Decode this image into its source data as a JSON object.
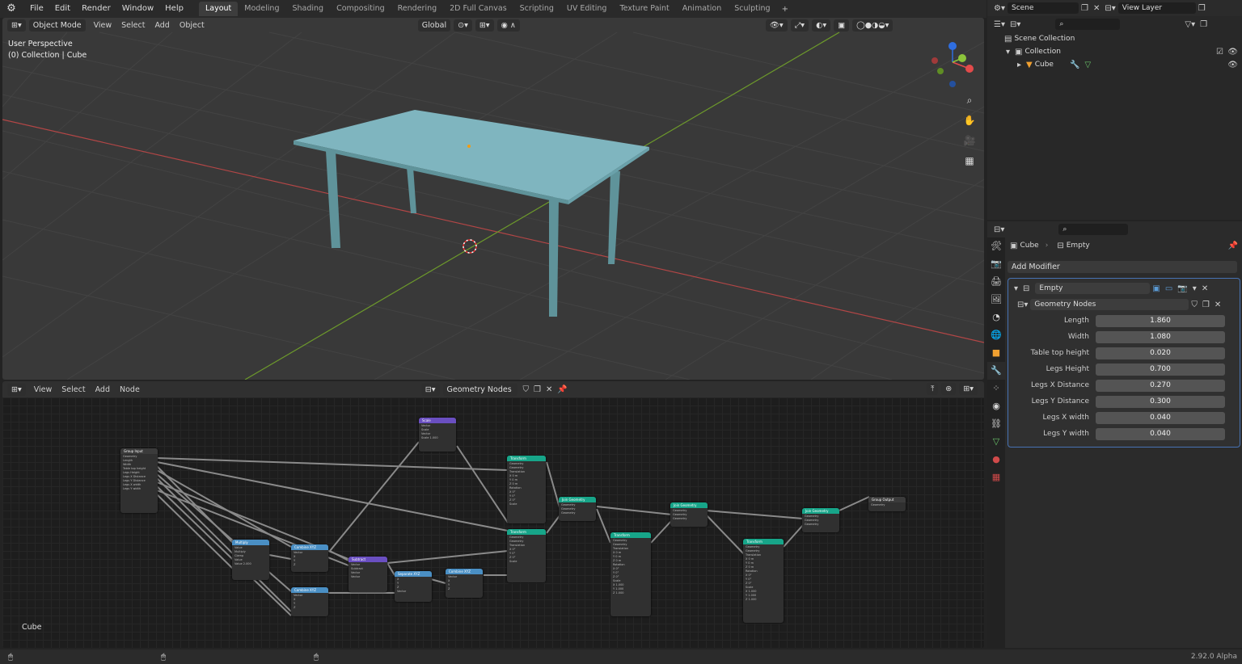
{
  "topbar": {
    "menus": [
      "File",
      "Edit",
      "Render",
      "Window",
      "Help"
    ],
    "workspaces": [
      "Layout",
      "Modeling",
      "Shading",
      "Compositing",
      "Rendering",
      "2D Full Canvas",
      "Scripting",
      "UV Editing",
      "Texture Paint",
      "Animation",
      "Sculpting"
    ],
    "active_workspace": "Layout",
    "plus": "+",
    "scene": "Scene",
    "view_layer": "View Layer"
  },
  "viewport": {
    "mode": "Object Mode",
    "menus": [
      "View",
      "Select",
      "Add",
      "Object"
    ],
    "orientation": "Global",
    "info_line1": "User Perspective",
    "info_line2": "(0) Collection | Cube",
    "tool_icons": [
      "zoom-icon",
      "hand-icon",
      "camera-icon",
      "grid-icon"
    ]
  },
  "node_editor": {
    "menus": [
      "View",
      "Select",
      "Add",
      "Node"
    ],
    "tree_name": "Geometry Nodes",
    "object_label": "Cube",
    "nodes": [
      {
        "id": "group_input",
        "title": "Group Input",
        "color": "#3b3b3b",
        "lines": [
          "Geometry",
          "Length",
          "Width",
          "Table top height",
          "Legs Height",
          "Legs X Distance",
          "Legs Y Distance",
          "Legs X width",
          "Legs Y width"
        ]
      },
      {
        "id": "scale",
        "title": "Scale",
        "color": "#6a4fc1",
        "lines": [
          "Vector",
          "Scale",
          "Vector",
          "Scale 1.000"
        ]
      },
      {
        "id": "multiply",
        "title": "Multiply",
        "color": "#4a8fc4",
        "lines": [
          "Value",
          "Multiply",
          "Clamp",
          "Value",
          "Value 2.000"
        ]
      },
      {
        "id": "combine1",
        "title": "Combine XYZ",
        "color": "#4a8fc4",
        "lines": [
          "Vector",
          "X",
          "Y",
          "Z"
        ]
      },
      {
        "id": "combine2",
        "title": "Combine XYZ",
        "color": "#4a8fc4",
        "lines": [
          "Vector",
          "X",
          "Y",
          "Z"
        ]
      },
      {
        "id": "subtract",
        "title": "Subtract",
        "color": "#6a4fc1",
        "lines": [
          "Vector",
          "Subtract",
          "Vector",
          "Vector"
        ]
      },
      {
        "id": "separate",
        "title": "Separate XYZ",
        "color": "#4a8fc4",
        "lines": [
          "X",
          "Y",
          "Z",
          "Vector"
        ]
      },
      {
        "id": "combine3",
        "title": "Combine XYZ",
        "color": "#4a8fc4",
        "lines": [
          "Vector",
          "X",
          "Y",
          "Z"
        ]
      },
      {
        "id": "transform1",
        "title": "Transform",
        "color": "#17a589",
        "lines": [
          "Geometry",
          "Geometry",
          "Translation",
          "X 0 m",
          "Y 0 m",
          "Z 0 m",
          "Rotation",
          "X 0°",
          "Y 0°",
          "Z 0°",
          "Scale"
        ]
      },
      {
        "id": "transform2",
        "title": "Transform",
        "color": "#17a589",
        "lines": [
          "Geometry",
          "Geometry",
          "Translation",
          "X 0°",
          "Y 0°",
          "Z 0°",
          "Scale"
        ]
      },
      {
        "id": "join1",
        "title": "Join Geometry",
        "color": "#17a589",
        "lines": [
          "Geometry",
          "Geometry",
          "Geometry"
        ]
      },
      {
        "id": "transform3",
        "title": "Transform",
        "color": "#17a589",
        "lines": [
          "Geometry",
          "Geometry",
          "Translation",
          "X 0 m",
          "Y 0 m",
          "Z 0 m",
          "Rotation",
          "X 0°",
          "Y 0°",
          "Z 0°",
          "Scale",
          "X 1.000",
          "Y 1.000",
          "Z 1.000"
        ]
      },
      {
        "id": "join2",
        "title": "Join Geometry",
        "color": "#17a589",
        "lines": [
          "Geometry",
          "Geometry",
          "Geometry"
        ]
      },
      {
        "id": "transform4",
        "title": "Transform",
        "color": "#17a589",
        "lines": [
          "Geometry",
          "Geometry",
          "Translation",
          "X 0 m",
          "Y 0 m",
          "Z 0 m",
          "Rotation",
          "X 0°",
          "Y 0°",
          "Z 0°",
          "Scale",
          "X 1.000",
          "Y 1.000",
          "Z 1.000"
        ]
      },
      {
        "id": "join3",
        "title": "Join Geometry",
        "color": "#17a589",
        "lines": [
          "Geometry",
          "Geometry",
          "Geometry"
        ]
      },
      {
        "id": "group_output",
        "title": "Group Output",
        "color": "#3b3b3b",
        "lines": [
          "Geometry"
        ]
      }
    ]
  },
  "outliner": {
    "scene_collection": "Scene Collection",
    "collection": "Collection",
    "object": "Cube"
  },
  "properties": {
    "object_name": "Cube",
    "modifier_data": "Empty",
    "add_modifier": "Add Modifier",
    "modifier_name": "Empty",
    "node_group": "Geometry Nodes",
    "inputs": [
      {
        "label": "Length",
        "value": "1.860"
      },
      {
        "label": "Width",
        "value": "1.080"
      },
      {
        "label": "Table top height",
        "value": "0.020"
      },
      {
        "label": "Legs Height",
        "value": "0.700"
      },
      {
        "label": "Legs X Distance",
        "value": "0.270"
      },
      {
        "label": "Legs Y Distance",
        "value": "0.300"
      },
      {
        "label": "Legs X width",
        "value": "0.040"
      },
      {
        "label": "Legs Y width",
        "value": "0.040"
      }
    ]
  },
  "status": {
    "version": "2.92.0 Alpha"
  },
  "colors": {
    "accent": "#4772b3",
    "table": "#7fb5bf",
    "x_axis": "#c94545",
    "y_axis": "#7ea733"
  }
}
